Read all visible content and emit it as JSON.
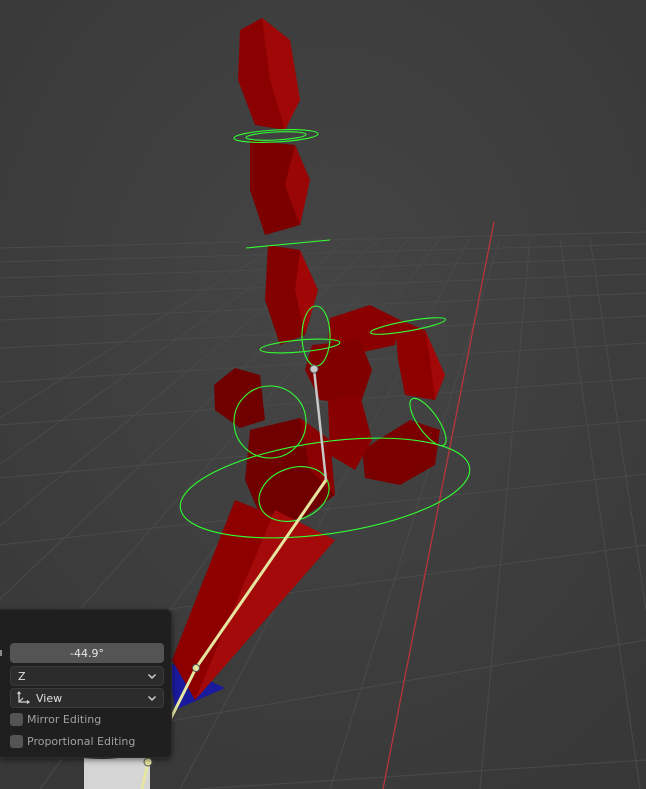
{
  "operator_panel": {
    "angle_value": "-44.9°",
    "axis_select": "Z",
    "orientation_select": "View",
    "mirror_editing_label": "Mirror Editing",
    "mirror_editing_checked": false,
    "proportional_editing_label": "Proportional Editing",
    "proportional_editing_checked": false
  },
  "viewport": {
    "background_color": "#3d3d3d",
    "mesh_color": "#8b0000",
    "bone_gizmo_color": "#32ff32",
    "selected_bone_color": "#e6e6a0",
    "ground_color": "#1a1a9c"
  }
}
